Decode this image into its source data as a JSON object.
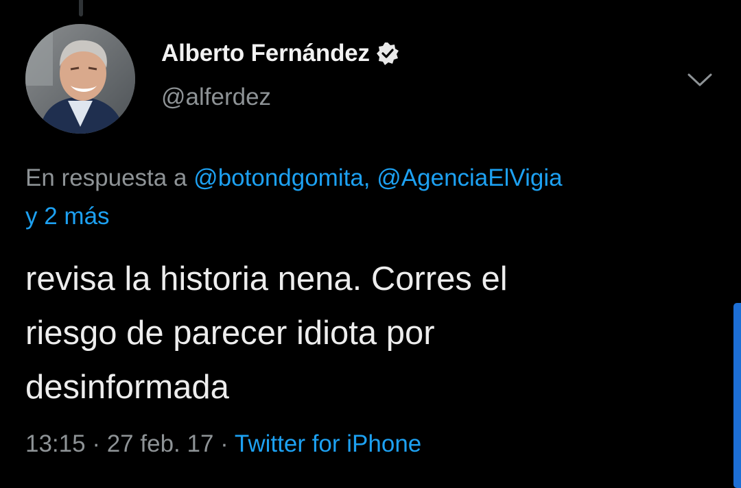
{
  "tweet": {
    "author": {
      "display_name": "Alberto Fernández",
      "handle": "@alferdez",
      "verified": true
    },
    "reply_prefix": "En respuesta a",
    "reply_mentions": [
      "@botondgomita,",
      "@AgenciaElVigia"
    ],
    "reply_more": "y 2 más",
    "text_lines": [
      "revisa la historia nena. Corres el",
      "riesgo de parecer idiota por",
      "desinformada"
    ],
    "time": "13:15",
    "separator": "·",
    "date": "27 feb. 17",
    "source": "Twitter for iPhone"
  },
  "icons": {
    "verified": "verified-badge-icon",
    "menu": "chevron-down-icon"
  },
  "colors": {
    "background": "#000000",
    "link": "#1da1f2",
    "muted": "#8e9396",
    "text": "#ededed",
    "scrollbar": "#1d6fd6"
  }
}
